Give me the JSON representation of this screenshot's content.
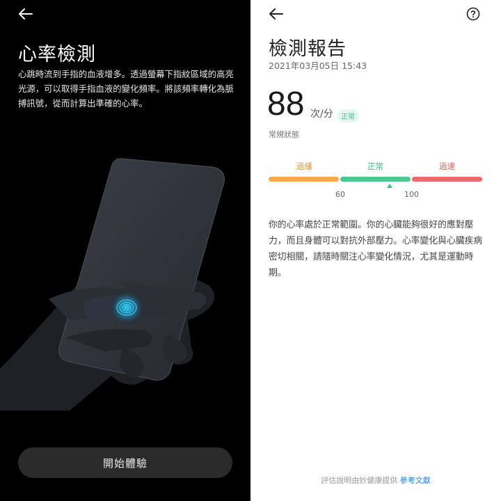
{
  "left_screen": {
    "title": "心率檢測",
    "description": "心跳時流到手指的血液增多。透過螢幕下指紋區域的高亮光源，可以取得手指血液的變化頻率。將該頻率轉化為脈搏訊號，從而計算出準確的心率。",
    "start_button": "開始體驗"
  },
  "right_screen": {
    "title": "檢測報告",
    "datetime": "2021年03月05日 15:43",
    "heart_rate": "88",
    "unit": "次/分",
    "status_badge": "正常",
    "state_label": "常規狀態",
    "scale": {
      "labels": [
        "過緩",
        "正常",
        "過速"
      ],
      "ticks": [
        "60",
        "100"
      ],
      "colors": [
        "#f6a94a",
        "#49c98f",
        "#ee6a6a"
      ],
      "current_value": 88
    },
    "description": "你的心率處於正常範圍。你的心臟能夠很好的應對壓力，而且身體可以對抗外部壓力。心率變化與心臟疾病密切相關，請隨時關注心率變化情況，尤其是運動時期。",
    "footer_text": "評估說明由妙健康提供",
    "footer_link": "參考文獻"
  },
  "colors": {
    "accent_green": "#3bbf85",
    "link_blue": "#1f7df0",
    "fingerprint_glow": "#2fd3ff"
  },
  "icons": {
    "back": "arrow-left-icon",
    "help": "question-circle-icon",
    "illustration": "hand-holding-phone-fingerprint"
  }
}
